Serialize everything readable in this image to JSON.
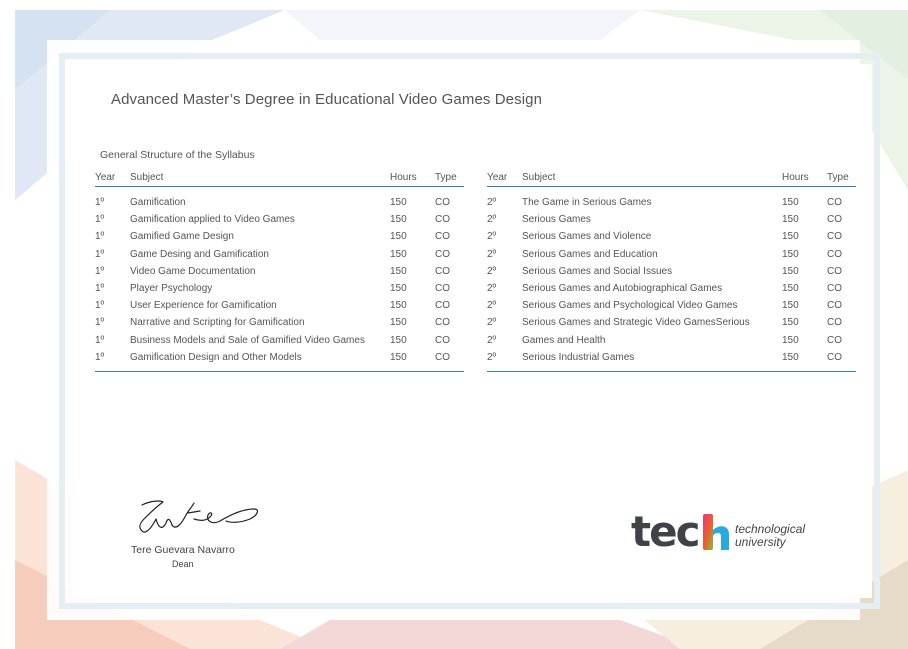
{
  "title": "Advanced Master’s Degree in Educational Video Games Design",
  "subtitle": "General Structure of the Syllabus",
  "columns": {
    "year": "Year",
    "subject": "Subject",
    "hours": "Hours",
    "type": "Type"
  },
  "table_left": [
    {
      "year": "1º",
      "subject": "Gamification",
      "hours": "150",
      "type": "CO"
    },
    {
      "year": "1º",
      "subject": "Gamification applied to Video Games",
      "hours": "150",
      "type": "CO"
    },
    {
      "year": "1º",
      "subject": "Gamified Game Design",
      "hours": "150",
      "type": "CO"
    },
    {
      "year": "1º",
      "subject": "Game Desing and Gamification",
      "hours": "150",
      "type": "CO"
    },
    {
      "year": "1º",
      "subject": "Video Game Documentation",
      "hours": "150",
      "type": "CO"
    },
    {
      "year": "1º",
      "subject": "Player Psychology",
      "hours": "150",
      "type": "CO"
    },
    {
      "year": "1º",
      "subject": "User Experience for Gamification",
      "hours": "150",
      "type": "CO"
    },
    {
      "year": "1º",
      "subject": "Narrative and Scripting for Gamification",
      "hours": "150",
      "type": "CO"
    },
    {
      "year": "1º",
      "subject": "Business Models and Sale of Gamified Video Games",
      "hours": "150",
      "type": "CO"
    },
    {
      "year": "1º",
      "subject": "Gamification Design and Other Models",
      "hours": "150",
      "type": "CO"
    }
  ],
  "table_right": [
    {
      "year": "2º",
      "subject": "The Game in Serious Games",
      "hours": "150",
      "type": "CO"
    },
    {
      "year": "2º",
      "subject": "Serious Games",
      "hours": "150",
      "type": "CO"
    },
    {
      "year": "2º",
      "subject": "Serious Games and Violence",
      "hours": "150",
      "type": "CO"
    },
    {
      "year": "2º",
      "subject": "Serious Games and Education",
      "hours": "150",
      "type": "CO"
    },
    {
      "year": "2º",
      "subject": "Serious Games and Social Issues",
      "hours": "150",
      "type": "CO"
    },
    {
      "year": "2º",
      "subject": "Serious Games and Autobiographical Games",
      "hours": "150",
      "type": "CO"
    },
    {
      "year": "2º",
      "subject": "Serious Games and Psychological Video Games",
      "hours": "150",
      "type": "CO"
    },
    {
      "year": "2º",
      "subject": "Serious Games and Strategic Video GamesSerious",
      "hours": "150",
      "type": "CO"
    },
    {
      "year": "2º",
      "subject": "Games and Health",
      "hours": "150",
      "type": "CO"
    },
    {
      "year": "2º",
      "subject": "Serious Industrial Games",
      "hours": "150",
      "type": "CO"
    }
  ],
  "signature": {
    "name": "Tere Guevara Navarro",
    "role": "Dean"
  },
  "logo": {
    "word": "tech",
    "line1": "technological",
    "line2": "university"
  },
  "colors": {
    "accent": "#3a7bbf",
    "text": "#4a4a4a",
    "logo": "#3f4246"
  }
}
